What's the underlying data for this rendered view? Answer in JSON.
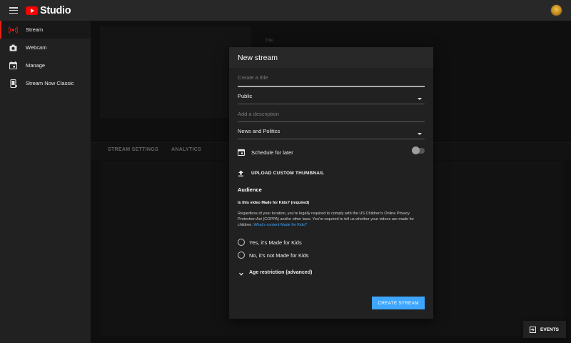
{
  "app": {
    "logo_text": "Studio",
    "brand_color": "#ff0000",
    "accent_color": "#3ea6ff"
  },
  "sidebar": {
    "items": [
      {
        "label": "Stream",
        "icon": "broadcast-icon",
        "active": true
      },
      {
        "label": "Webcam",
        "icon": "camera-icon",
        "active": false
      },
      {
        "label": "Manage",
        "icon": "calendar-icon",
        "active": false
      },
      {
        "label": "Stream Now Classic",
        "icon": "phone-icon",
        "active": false
      }
    ]
  },
  "background": {
    "title_ghost": "Title",
    "tabs": [
      "STREAM SETTINGS",
      "ANALYTICS"
    ]
  },
  "dialog": {
    "title": "New stream",
    "title_placeholder": "Create a title",
    "visibility": "Public",
    "description_placeholder": "Add a description",
    "category": "News and Politics",
    "schedule_label": "Schedule for later",
    "schedule_enabled": false,
    "upload_thumbnail_label": "UPLOAD CUSTOM THUMBNAIL",
    "audience_title": "Audience",
    "kids_question": "Is this video Made for Kids? (required)",
    "kids_description": "Regardless of your location, you're legally required to comply with the US Children's Online Privacy Protection Act (COPPA) and/or other laws. You're required to tell us whether your videos are made for children.",
    "kids_link": "What's content Made for Kids?",
    "radio_yes": "Yes, it's Made for Kids",
    "radio_no": "No, it's not Made for Kids",
    "age_restriction": "Age restriction (advanced)",
    "create_button": "CREATE STREAM"
  },
  "events_button": "EVENTS"
}
